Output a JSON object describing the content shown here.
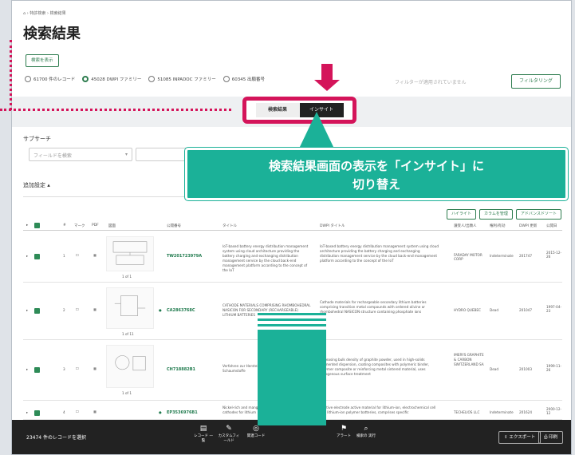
{
  "breadcrumb": {
    "home_icon": "home-icon",
    "item1": "特許検索",
    "item2": "検索結果"
  },
  "page_title": "検索結果",
  "show_search_button": "検索を表示",
  "radios": [
    {
      "label": "61700 件のレコード",
      "selected": false
    },
    {
      "label": "45028 DWPI ファミリー",
      "selected": true
    },
    {
      "label": "51085 INPADOC ファミリー",
      "selected": false
    },
    {
      "label": "60345 出願番号",
      "selected": false
    }
  ],
  "filter_note": "フィルターが適用されていません",
  "filter_button": "フィルタリング",
  "tabs": {
    "results": "検索結果",
    "insight": "インサイト"
  },
  "subsearch": {
    "label": "サブサーチ",
    "field_placeholder": "フィールドを検索"
  },
  "additional_settings": "追加設定",
  "table_buttons": [
    "ハイライト",
    "カラムを管理",
    "アドバンスドソート"
  ],
  "table_headers": [
    "#",
    "マーク",
    "PDF",
    "図面",
    "公開番号",
    "タイトル",
    "DWPI タイトル",
    "譲受人/出願人",
    "権利/有効",
    "DWPI 更新",
    "公開日"
  ],
  "rows": [
    {
      "num": "1",
      "pn": "TW201723979A",
      "title": "IoT-based battery energy distribution management system using cloud architecture providing the battery charging and exchanging distribution management service by the cloud back-end management platform according to the concept of the IoT",
      "dwpi": "IoT-based battery energy distribution management system using cloud architecture providing the battery charging and exchanging distribution management service by the cloud back-end management platform according to the concept of the IoT",
      "assignee": "FARADAY MOTOR CORP",
      "status": "Indeterminate",
      "update": "201747",
      "date": "2015-12-26",
      "pages": "1 of 1"
    },
    {
      "num": "2",
      "pn": "CA2863768C",
      "title": "CATHODE MATERIALS COMPRISING RHOMBOHEDRAL NASICON FOR SECONDARY (RECHARGEABLE) LITHIUM BATTERIES",
      "dwpi": "Cathode materials for rechargeable secondary lithium batteries comprising transition metal compounds with ordered olivine or rhombohedral NASICON structure containing phosphate ions",
      "assignee": "HYDRO QUEBEC",
      "status": "Dead",
      "update": "201047",
      "date": "1997-04-23",
      "pages": "1 of 11"
    },
    {
      "num": "3",
      "pn": "CH718882B1",
      "title": "Verfahren zur Herstellung von Graphit enthaltender Schaumstoffe",
      "dwpi": "Increasing bulk density of graphite powder, used in high-solids pigmented dispersion, coating composites with polymeric binder, polymer composite or reinforcing metal sintered material, uses autogenous surface treatment",
      "assignee": "IMERYS GRAPHITE & CARBON SWITZERLAND SA",
      "status": "Dead",
      "update": "201003",
      "date": "1999-11-26",
      "pages": "1 of 1"
    },
    {
      "num": "4",
      "pn": "EP3536976B1",
      "title": "Nickel-rich and manganese-rich materials as cathodes for lithium",
      "dwpi": "Positive electrode active material for lithium-ion, electrochemical cell and lithium-ion polymer batteries, comprises specific",
      "assignee": "TECHELIOS LLC",
      "status": "Indeterminate",
      "update": "201624",
      "date": "2000-12-12",
      "pages": ""
    }
  ],
  "callout": {
    "line1": "検索結果画面の表示を「インサイト」に",
    "line2": "切り替え"
  },
  "footer": {
    "selected": "23474 件のレコードを選択",
    "icons": [
      {
        "name": "record-view-icon",
        "glyph": "▤",
        "label": "レコード 一覧"
      },
      {
        "name": "custom-field-icon",
        "glyph": "✎",
        "label": "カスタムフィールド"
      },
      {
        "name": "related-icon",
        "glyph": "◎",
        "label": "関連コード"
      },
      {
        "name": "ip-icon",
        "glyph": "⚑",
        "label": "アラート"
      },
      {
        "name": "search-exec-icon",
        "glyph": "⌕",
        "label": "検索の 実行"
      }
    ],
    "export": "エクスポート",
    "print": "印刷"
  },
  "colors": {
    "brand_green": "#2e7d4f",
    "accent_pink": "#d4145a",
    "callout_teal": "#1bb198"
  }
}
